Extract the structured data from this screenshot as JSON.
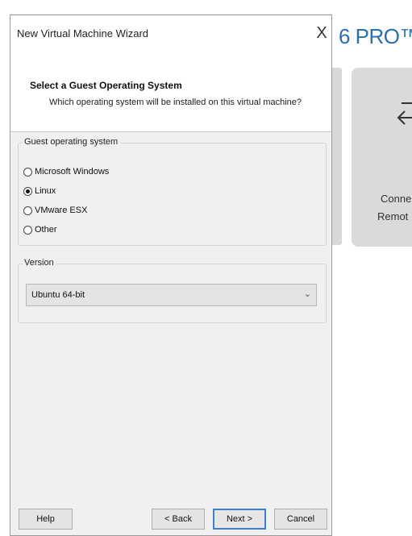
{
  "background": {
    "app_title": "6 PRO™",
    "card_label_line1": "Conne",
    "card_label_line2": "Remot"
  },
  "dialog": {
    "title": "New Virtual Machine Wizard",
    "close_glyph": "X",
    "heading": "Select a Guest Operating System",
    "subheading": "Which operating system will be installed on this virtual machine?",
    "os_group_label": "Guest operating system",
    "os_options": [
      {
        "label": "Microsoft Windows",
        "selected": false
      },
      {
        "label": "Linux",
        "selected": true
      },
      {
        "label": "VMware ESX",
        "selected": false
      },
      {
        "label": "Other",
        "selected": false
      }
    ],
    "version_group_label": "Version",
    "version_value": "Ubuntu 64-bit",
    "buttons": {
      "help": "Help",
      "back": "< Back",
      "next": "Next >",
      "cancel": "Cancel"
    }
  },
  "colors": {
    "brand_blue": "#2a6fb3",
    "focus_blue": "#3c7fd6"
  }
}
